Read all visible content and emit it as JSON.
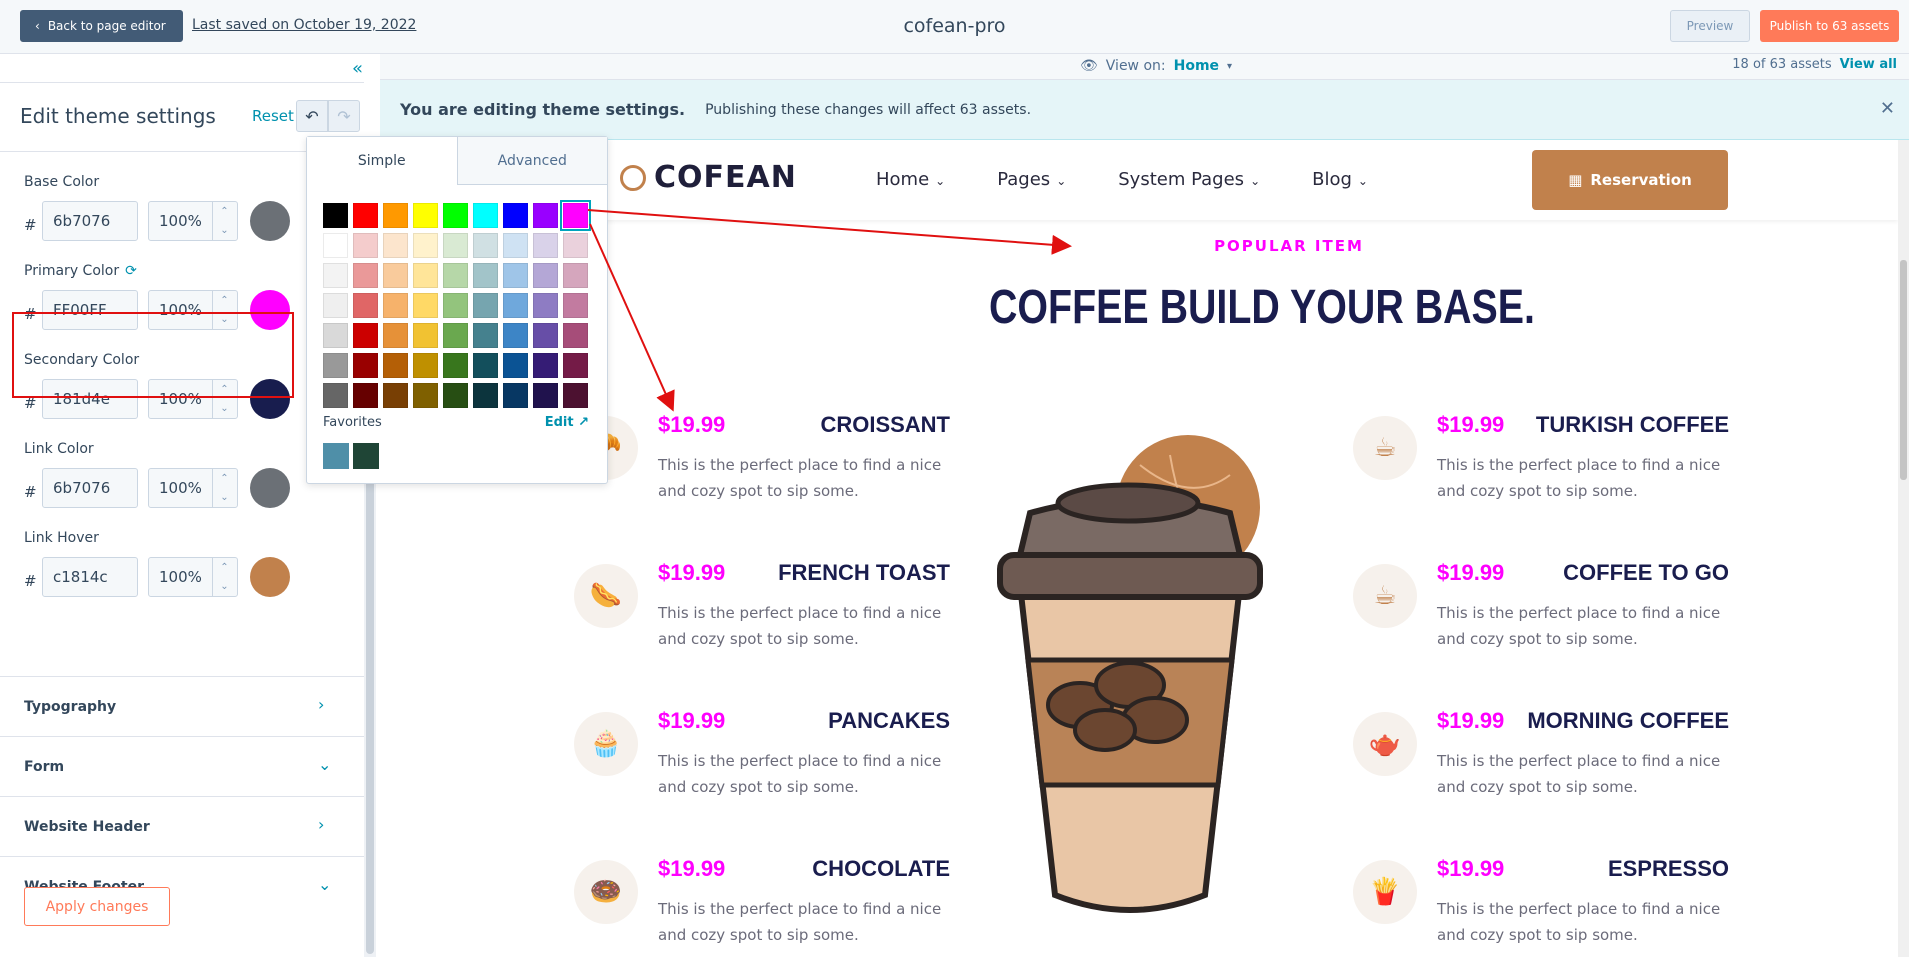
{
  "topbar": {
    "back_label": "Back to page editor",
    "last_saved": "Last saved on October 19, 2022",
    "app_title": "cofean-pro",
    "preview_label": "Preview",
    "publish_label": "Publish to 63 assets"
  },
  "sidebar": {
    "title": "Edit theme settings",
    "reset_label": "Reset",
    "colors": [
      {
        "label": "Base Color",
        "hex": "6b7076",
        "opacity": "100%",
        "swatch": "#6b7076"
      },
      {
        "label": "Primary Color",
        "hex": "FF00FF",
        "opacity": "100%",
        "swatch": "#ff00ff"
      },
      {
        "label": "Secondary Color",
        "hex": "181d4e",
        "opacity": "100%",
        "swatch": "#181d4e"
      },
      {
        "label": "Link Color",
        "hex": "6b7076",
        "opacity": "100%",
        "swatch": "#6b7076"
      },
      {
        "label": "Link Hover",
        "hex": "c1814c",
        "opacity": "100%",
        "swatch": "#c1814c"
      }
    ],
    "hash": "#",
    "sections": [
      {
        "label": "Typography",
        "chevron": "›"
      },
      {
        "label": "Form",
        "chevron": "⌄"
      },
      {
        "label": "Website Header",
        "chevron": "›"
      },
      {
        "label": "Website Footer",
        "chevron": "⌄"
      }
    ],
    "apply_label": "Apply changes"
  },
  "viewbar": {
    "view_on_label": "View on:",
    "view_on_value": "Home",
    "assets_count": "18 of 63 assets",
    "view_all": "View all"
  },
  "banner": {
    "title": "You are editing theme settings.",
    "description": "Publishing these changes will affect 63 assets."
  },
  "picker": {
    "tab_simple": "Simple",
    "tab_advanced": "Advanced",
    "favorites_label": "Favorites",
    "edit_label": "Edit",
    "grid": [
      [
        "#000000",
        "#ff0000",
        "#ff9900",
        "#ffff00",
        "#00ff00",
        "#00ffff",
        "#0000ff",
        "#9900ff",
        "#ff00ff"
      ],
      [
        "#ffffff",
        "#f4cccc",
        "#fce5cd",
        "#fff2cc",
        "#d9ead3",
        "#d0e0e3",
        "#cfe2f3",
        "#d9d2e9",
        "#ead1dc"
      ],
      [
        "#f3f3f3",
        "#ea9999",
        "#f9cb9c",
        "#ffe599",
        "#b6d7a8",
        "#a2c4c9",
        "#9fc5e8",
        "#b4a7d6",
        "#d5a6bd"
      ],
      [
        "#efefef",
        "#e06666",
        "#f6b26b",
        "#ffd966",
        "#93c47d",
        "#76a5af",
        "#6fa8dc",
        "#8e7cc3",
        "#c27ba0"
      ],
      [
        "#d9d9d9",
        "#cc0000",
        "#e69138",
        "#f1c232",
        "#6aa84f",
        "#45818e",
        "#3d85c6",
        "#674ea7",
        "#a64d79"
      ],
      [
        "#999999",
        "#990000",
        "#b45f06",
        "#bf9000",
        "#38761d",
        "#134f5c",
        "#0b5394",
        "#351c75",
        "#741b47"
      ],
      [
        "#666666",
        "#660000",
        "#783f04",
        "#7f6000",
        "#274e13",
        "#0c343d",
        "#073763",
        "#20124d",
        "#4c1130"
      ]
    ],
    "favorites": [
      "#4f8fa8",
      "#1f4536"
    ]
  },
  "site": {
    "logo": "COFEAN",
    "nav": [
      "Home",
      "Pages",
      "System Pages",
      "Blog"
    ],
    "reservation": "Reservation",
    "popular": "POPULAR ITEM",
    "heading": "COFFEE BUILD YOUR BASE.",
    "left_items": [
      {
        "price": "$19.99",
        "name": "CROISSANT",
        "desc": "This is the perfect place to find a nice and cozy spot to sip some.",
        "icon": "croissant-icon",
        "glyph": "🥐"
      },
      {
        "price": "$19.99",
        "name": "FRENCH TOAST",
        "desc": "This is the perfect place to find a nice and cozy spot to sip some.",
        "icon": "toast-icon",
        "glyph": "🌭"
      },
      {
        "price": "$19.99",
        "name": "PANCAKES",
        "desc": "This is the perfect place to find a nice and cozy spot to sip some.",
        "icon": "cupcake-icon",
        "glyph": "🧁"
      },
      {
        "price": "$19.99",
        "name": "CHOCOLATE",
        "desc": "This is the perfect place to find a nice and cozy spot to sip some.",
        "icon": "donut-icon",
        "glyph": "🍩"
      }
    ],
    "right_items": [
      {
        "price": "$19.99",
        "name": "TURKISH COFFEE",
        "desc": "This is the perfect place to find a nice and cozy spot to sip some.",
        "icon": "cup-icon",
        "glyph": "☕"
      },
      {
        "price": "$19.99",
        "name": "COFFEE TO GO",
        "desc": "This is the perfect place to find a nice and cozy spot to sip some.",
        "icon": "mug-icon",
        "glyph": "☕"
      },
      {
        "price": "$19.99",
        "name": "MORNING COFFEE",
        "desc": "This is the perfect place to find a nice and cozy spot to sip some.",
        "icon": "teapot-icon",
        "glyph": "🫖"
      },
      {
        "price": "$19.99",
        "name": "ESPRESSO",
        "desc": "This is the perfect place to find a nice and cozy spot to sip some.",
        "icon": "fries-icon",
        "glyph": "🍟"
      }
    ]
  }
}
